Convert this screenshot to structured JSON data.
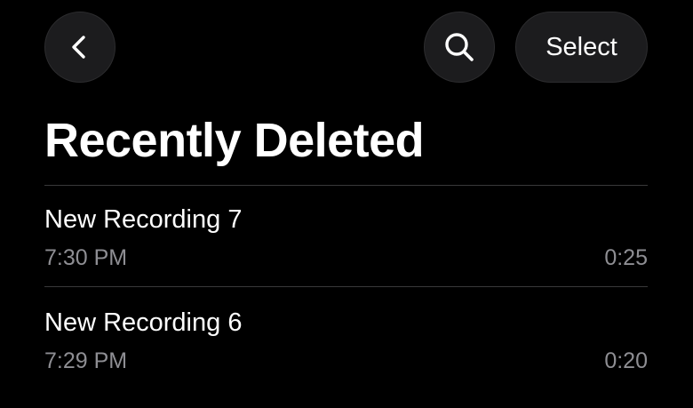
{
  "toolbar": {
    "back_icon": "chevron-left-icon",
    "search_icon": "magnifying-glass-icon",
    "select_label": "Select"
  },
  "header": {
    "title": "Recently Deleted"
  },
  "recordings": [
    {
      "name": "New Recording 7",
      "time": "7:30 PM",
      "duration": "0:25"
    },
    {
      "name": "New Recording 6",
      "time": "7:29 PM",
      "duration": "0:20"
    }
  ],
  "colors": {
    "background": "#000000",
    "button_fill": "#1c1c1e",
    "primary_text": "#ffffff",
    "secondary_text": "#8e8e93",
    "separator": "#38383a"
  }
}
